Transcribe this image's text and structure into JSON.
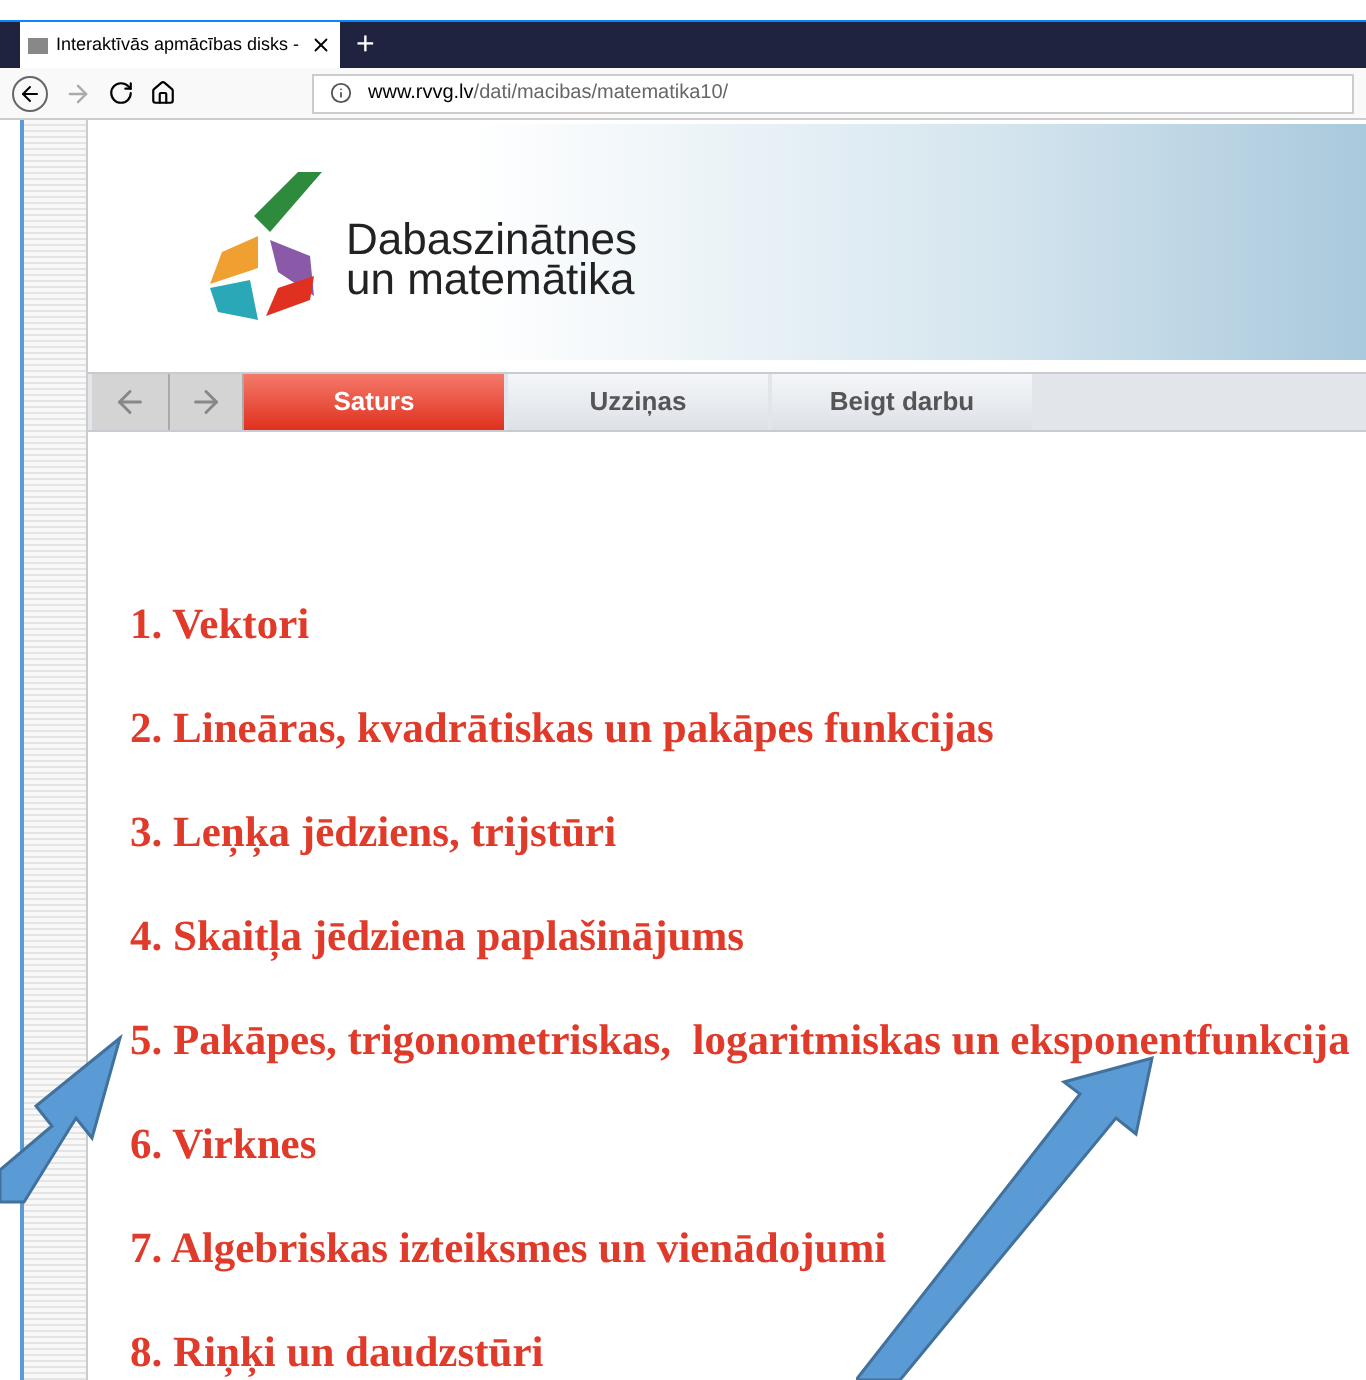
{
  "browser": {
    "tab_title": "Interaktīvās apmācības disks -",
    "new_tab": "+",
    "url_host": "www.rvvg.lv",
    "url_path": "/dati/macibas/matematika10/"
  },
  "logo": {
    "line1": "Dabaszinātnes",
    "line2": "un matemātika"
  },
  "nav": [
    {
      "label": "Saturs",
      "selected": true
    },
    {
      "label": "Uzziņas",
      "selected": false
    },
    {
      "label": "Beigt darbu",
      "selected": false
    }
  ],
  "chapters": [
    "1. Vektori",
    "2. Lineāras, kvadrātiskas un pakāpes funkcijas",
    "3. Leņķa jēdziens, trijstūri",
    "4. Skaitļa jēdziena paplašinājums",
    "5. Pakāpes, trigonometriskas,  logaritmiskas un eksponentfunkcija",
    "6. Virknes",
    "7. Algebriskas izteiksmes un vienādojumi",
    "8. Riņķi un daudzstūri"
  ]
}
